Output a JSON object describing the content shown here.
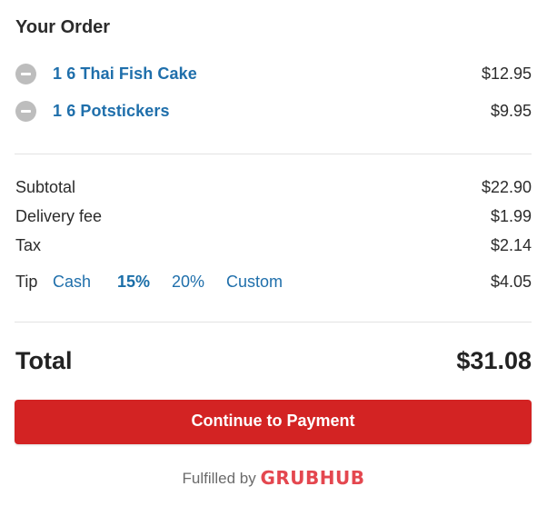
{
  "order": {
    "title": "Your Order",
    "items": [
      {
        "name": "1 6 Thai Fish Cake",
        "price": "$12.95",
        "remove_icon": "minus-circle-icon"
      },
      {
        "name": "1 6 Potstickers",
        "price": "$9.95",
        "remove_icon": "minus-circle-icon"
      }
    ]
  },
  "summary": {
    "subtotal_label": "Subtotal",
    "subtotal_value": "$22.90",
    "delivery_label": "Delivery fee",
    "delivery_value": "$1.99",
    "tax_label": "Tax",
    "tax_value": "$2.14",
    "tip_label": "Tip",
    "tip_options": [
      "Cash",
      "15%",
      "20%",
      "Custom"
    ],
    "tip_selected": "15%",
    "tip_value": "$4.05",
    "total_label": "Total",
    "total_value": "$31.08"
  },
  "actions": {
    "continue_label": "Continue to Payment"
  },
  "footer": {
    "fulfilled_label": "Fulfilled by",
    "brand": "GRUBHUB"
  },
  "colors": {
    "link": "#1f6fab",
    "primary_button": "#d32323",
    "brand": "#e4474f",
    "remove_icon": "#bdbdbd"
  }
}
